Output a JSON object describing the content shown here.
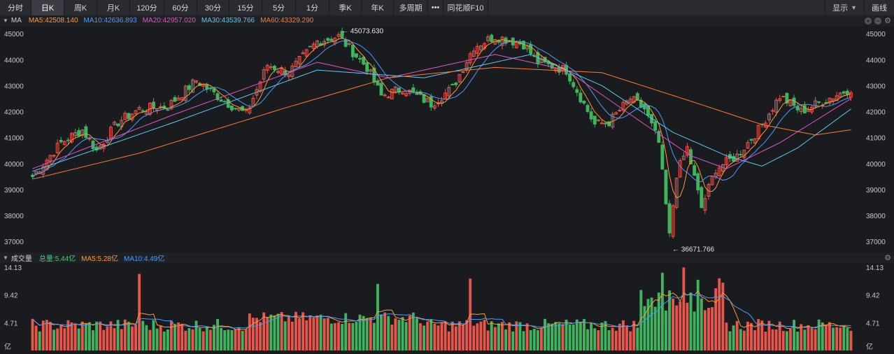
{
  "toolbar": {
    "tabs": [
      "分时",
      "日K",
      "周K",
      "月K",
      "120分",
      "60分",
      "30分",
      "15分",
      "5分",
      "1分",
      "季K",
      "年K",
      "多周期",
      "•••",
      "同花顺F10"
    ],
    "active": "日K",
    "display_label": "显示",
    "draw_label": "画线"
  },
  "ma_legend": {
    "name": "MA",
    "items": [
      {
        "text": "MA5:42508.140",
        "color": "#ff9a2e"
      },
      {
        "text": "MA10:42636.893",
        "color": "#4a9cff"
      },
      {
        "text": "MA20:42957.020",
        "color": "#e055c8"
      },
      {
        "text": "MA30:43539.766",
        "color": "#5bc8f5"
      },
      {
        "text": "MA60:43329.290",
        "color": "#ff7a30"
      }
    ]
  },
  "vol_legend": {
    "name": "成交量",
    "items": [
      {
        "text": "总量:5.44亿",
        "color": "#4fc878"
      },
      {
        "text": "MA5:5.28亿",
        "color": "#ff9a2e"
      },
      {
        "text": "MA10:4.49亿",
        "color": "#4a9cff"
      }
    ]
  },
  "colors": {
    "up": "#e8554a",
    "down": "#3fb45f",
    "bg": "#1a1b1f",
    "axis_text": "#c8c9cc"
  },
  "chart_data": [
    {
      "type": "candlestick",
      "title": "",
      "ylim": [
        36600,
        45300
      ],
      "yticks": [
        45000,
        44000,
        43000,
        42000,
        41000,
        40000,
        39000,
        38000,
        37000
      ],
      "annotations": {
        "max_label": "45073.630",
        "min_label": "36671.766"
      },
      "anchors": [
        {
          "i": 0,
          "v": 39500
        },
        {
          "i": 8,
          "v": 40800
        },
        {
          "i": 14,
          "v": 41300
        },
        {
          "i": 18,
          "v": 40500
        },
        {
          "i": 24,
          "v": 41600
        },
        {
          "i": 30,
          "v": 42100
        },
        {
          "i": 38,
          "v": 42200
        },
        {
          "i": 46,
          "v": 43200
        },
        {
          "i": 54,
          "v": 42400
        },
        {
          "i": 60,
          "v": 41900
        },
        {
          "i": 66,
          "v": 43800
        },
        {
          "i": 72,
          "v": 43500
        },
        {
          "i": 80,
          "v": 44700
        },
        {
          "i": 86,
          "v": 44900
        },
        {
          "i": 94,
          "v": 43700
        },
        {
          "i": 98,
          "v": 42600
        },
        {
          "i": 104,
          "v": 42900
        },
        {
          "i": 112,
          "v": 42300
        },
        {
          "i": 118,
          "v": 42900
        },
        {
          "i": 124,
          "v": 44500
        },
        {
          "i": 130,
          "v": 44900
        },
        {
          "i": 138,
          "v": 44600
        },
        {
          "i": 142,
          "v": 43900
        },
        {
          "i": 150,
          "v": 43600
        },
        {
          "i": 158,
          "v": 41500
        },
        {
          "i": 162,
          "v": 41600
        },
        {
          "i": 168,
          "v": 42500
        },
        {
          "i": 172,
          "v": 42100
        },
        {
          "i": 176,
          "v": 40800
        },
        {
          "i": 179,
          "v": 37200
        },
        {
          "i": 181,
          "v": 39600
        },
        {
          "i": 184,
          "v": 40600
        },
        {
          "i": 188,
          "v": 38300
        },
        {
          "i": 192,
          "v": 39800
        },
        {
          "i": 198,
          "v": 40300
        },
        {
          "i": 204,
          "v": 41300
        },
        {
          "i": 210,
          "v": 42600
        },
        {
          "i": 216,
          "v": 42000
        },
        {
          "i": 222,
          "v": 42400
        },
        {
          "i": 230,
          "v": 42900
        }
      ],
      "ma_lines": {
        "MA20": [
          [
            0,
            39800
          ],
          [
            40,
            41900
          ],
          [
            80,
            43900
          ],
          [
            100,
            43300
          ],
          [
            130,
            44200
          ],
          [
            150,
            43600
          ],
          [
            170,
            41700
          ],
          [
            185,
            40300
          ],
          [
            195,
            39800
          ],
          [
            210,
            40800
          ],
          [
            230,
            42500
          ]
        ],
        "MA30": [
          [
            0,
            39700
          ],
          [
            40,
            41600
          ],
          [
            80,
            43600
          ],
          [
            110,
            43300
          ],
          [
            140,
            44200
          ],
          [
            160,
            43000
          ],
          [
            180,
            41200
          ],
          [
            195,
            40300
          ],
          [
            205,
            39900
          ],
          [
            215,
            40600
          ],
          [
            230,
            42100
          ]
        ],
        "MA60": [
          [
            0,
            39400
          ],
          [
            30,
            40400
          ],
          [
            70,
            42100
          ],
          [
            100,
            43300
          ],
          [
            130,
            43700
          ],
          [
            160,
            43500
          ],
          [
            185,
            42400
          ],
          [
            205,
            41500
          ],
          [
            220,
            41100
          ],
          [
            230,
            41300
          ]
        ]
      },
      "count": 231
    },
    {
      "type": "bar",
      "title": "成交量",
      "unit": "亿",
      "ylim": [
        0,
        14.13
      ],
      "yticks": [
        "14.13",
        "9.42",
        "4.71",
        "亿"
      ],
      "max_value": 14.13
    }
  ]
}
